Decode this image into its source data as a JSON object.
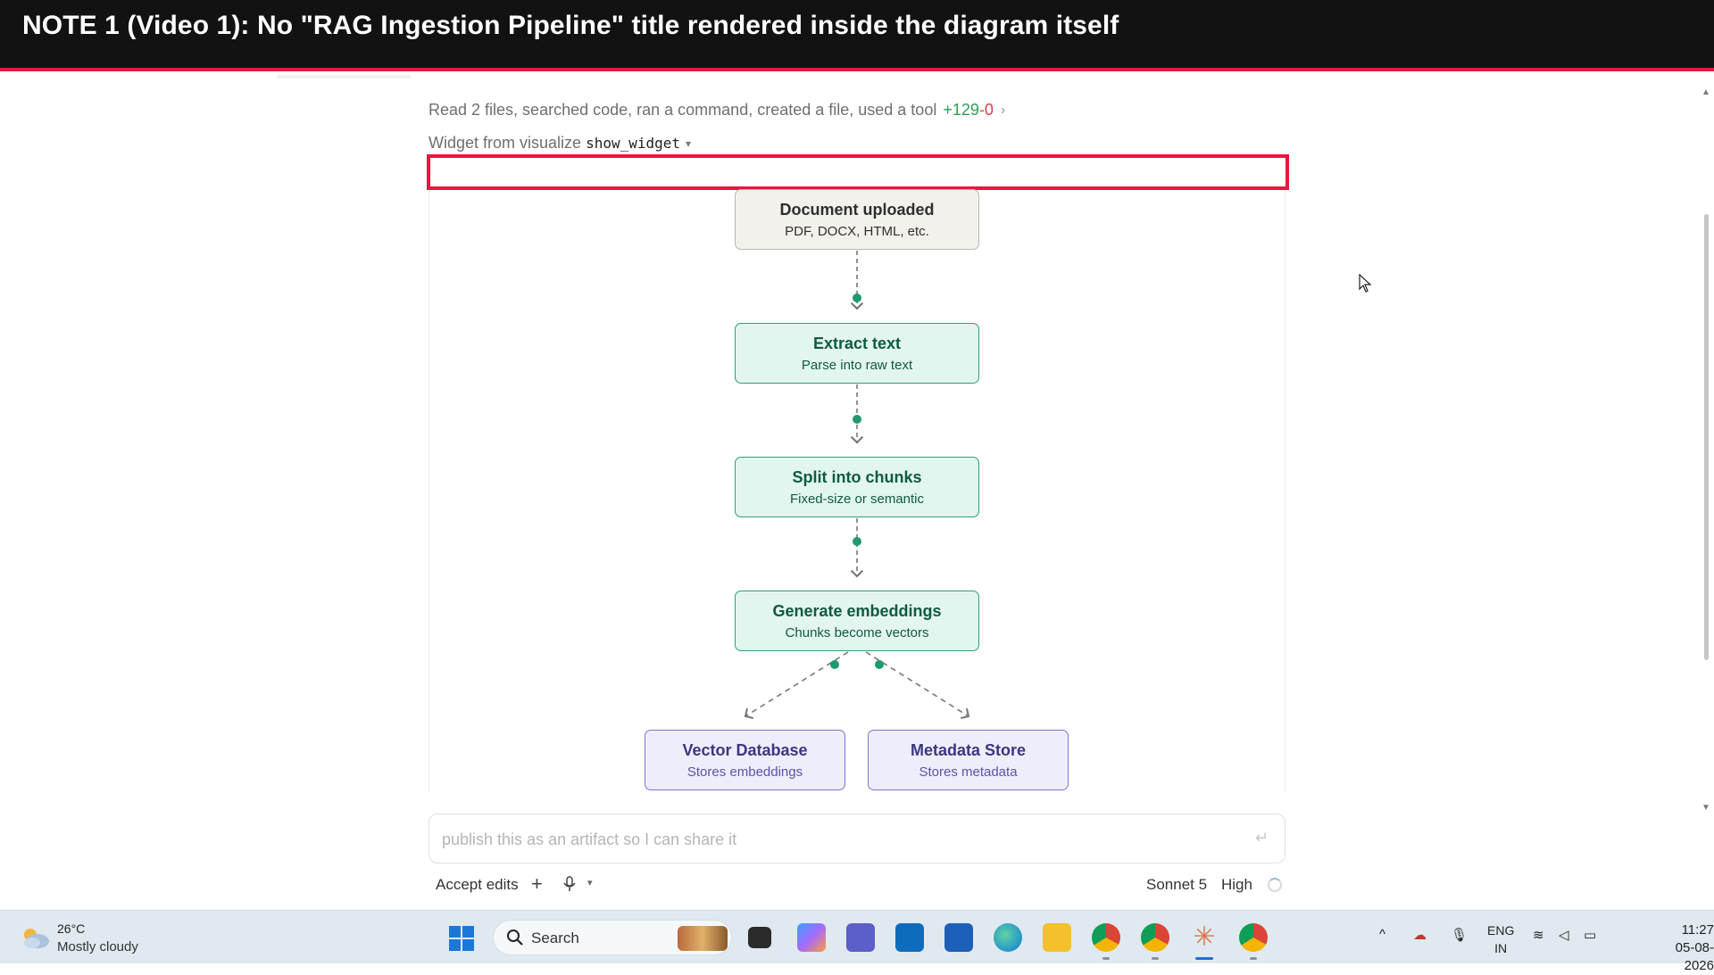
{
  "banner": {
    "text": "NOTE 1 (Video 1): No \"RAG Ingestion Pipeline\" title rendered inside the diagram itself"
  },
  "summary": {
    "text": "Read 2 files, searched code, ran a command, created a file, used a tool",
    "additions": "+129",
    "deletions": "-0"
  },
  "widget": {
    "label": "Widget from visualize",
    "tool": "show_widget"
  },
  "diagram": {
    "nodes": [
      {
        "title": "Document uploaded",
        "subtitle": "PDF, DOCX, HTML, etc.",
        "style": "gray"
      },
      {
        "title": "Extract text",
        "subtitle": "Parse into raw text",
        "style": "green"
      },
      {
        "title": "Split into chunks",
        "subtitle": "Fixed-size or semantic",
        "style": "green"
      },
      {
        "title": "Generate embeddings",
        "subtitle": "Chunks become vectors",
        "style": "green"
      },
      {
        "title": "Vector Database",
        "subtitle": "Stores embeddings",
        "style": "purple"
      },
      {
        "title": "Metadata Store",
        "subtitle": "Stores metadata",
        "style": "purple"
      }
    ],
    "colors": {
      "gray_border": "#b9b7af",
      "green_border": "#2f9e78",
      "purple_border": "#7d75d0",
      "edge": "#777777",
      "dot": "#1f9a6f"
    }
  },
  "composer": {
    "placeholder": "publish this as an artifact so I can share it",
    "accept_label": "Accept edits",
    "model": "Sonnet 5",
    "effort": "High"
  },
  "taskbar": {
    "weather": {
      "temp": "26°C",
      "condition": "Mostly cloudy"
    },
    "search_label": "Search",
    "language": {
      "line1": "ENG",
      "line2": "IN"
    },
    "clock": {
      "time": "11:27",
      "date": "05-08-2026"
    },
    "apps": [
      "task-view",
      "copilot",
      "teams",
      "outlook",
      "store",
      "edge",
      "file-explorer",
      "chrome-profile-a",
      "chrome-profile-b",
      "claude",
      "chrome-profile-c"
    ]
  }
}
